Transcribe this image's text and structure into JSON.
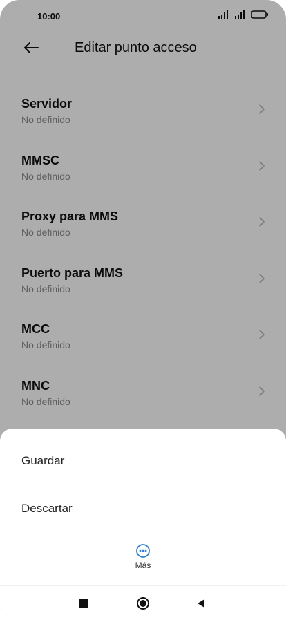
{
  "status_bar": {
    "time": "10:00",
    "icons": [
      "signal-icon",
      "signal-icon",
      "battery-icon"
    ]
  },
  "header": {
    "title": "Editar punto acceso",
    "back_icon": "arrow-left-icon"
  },
  "settings": [
    {
      "label": "Servidor",
      "value": "No definido"
    },
    {
      "label": "MMSC",
      "value": "No definido"
    },
    {
      "label": "Proxy para MMS",
      "value": "No definido"
    },
    {
      "label": "Puerto para MMS",
      "value": "No definido"
    },
    {
      "label": "MCC",
      "value": "No definido"
    },
    {
      "label": "MNC",
      "value": "No definido"
    }
  ],
  "bottom_sheet": {
    "options": [
      {
        "label": "Guardar"
      },
      {
        "label": "Descartar"
      }
    ],
    "more_label": "Más",
    "more_icon": "more-icon"
  },
  "nav_bar": {
    "buttons": [
      "recents-icon",
      "home-icon",
      "back-icon"
    ]
  },
  "colors": {
    "overlay": "rgba(0,0,0,0.32)",
    "accent": "#2f80d1",
    "secondary_text": "#8b8b8b"
  }
}
